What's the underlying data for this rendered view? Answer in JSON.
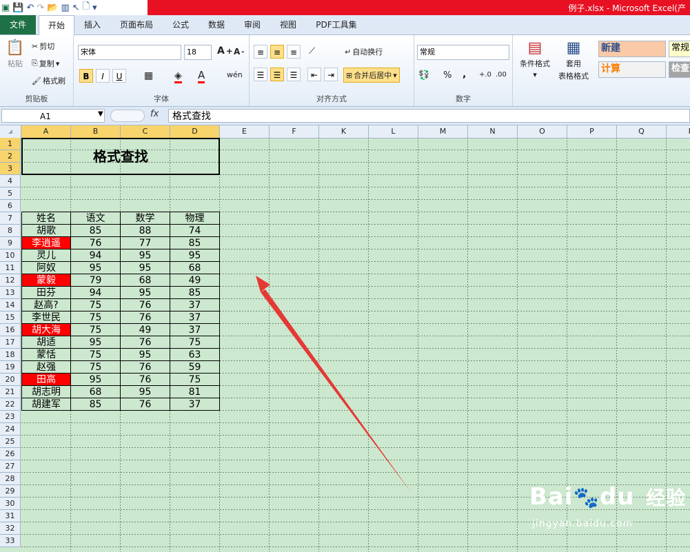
{
  "window": {
    "title": "例子.xlsx  -  Microsoft Excel(产"
  },
  "tabs": [
    "文件",
    "开始",
    "插入",
    "页面布局",
    "公式",
    "数据",
    "审阅",
    "视图",
    "PDF工具集"
  ],
  "ribbon": {
    "clipboard": {
      "label": "剪贴板",
      "paste": "粘贴",
      "cut": "剪切",
      "copy": "复制",
      "format_painter": "格式刷"
    },
    "font": {
      "label": "字体",
      "name": "宋体",
      "size": "18",
      "bold": "B",
      "italic": "I",
      "underline": "U"
    },
    "alignment": {
      "label": "对齐方式",
      "wrap": "自动换行",
      "merge": "合并后居中"
    },
    "number": {
      "label": "数字",
      "format": "常规",
      "percent": "%",
      "comma": ","
    },
    "styles": {
      "conditional": "条件格式",
      "table1": "套用",
      "table2": "表格格式",
      "style_new": "新建",
      "style_calc": "计算",
      "style_normal": "常规",
      "style_check": "检查"
    }
  },
  "formula_bar": {
    "name_box": "A1",
    "fx": "fx",
    "content": "格式查找"
  },
  "columns": [
    "A",
    "B",
    "C",
    "D",
    "E",
    "F",
    "K",
    "L",
    "M",
    "N",
    "O",
    "P",
    "Q",
    "R"
  ],
  "rows": [
    "1",
    "2",
    "3",
    "4",
    "5",
    "6",
    "7",
    "8",
    "9",
    "10",
    "11",
    "12",
    "13",
    "14",
    "15",
    "16",
    "17",
    "18",
    "19",
    "20",
    "21",
    "22",
    "23",
    "24",
    "25",
    "26",
    "27",
    "28",
    "29",
    "30",
    "31",
    "32",
    "33"
  ],
  "sheet": {
    "title": "格式查找",
    "headers": [
      "姓名",
      "语文",
      "数学",
      "物理"
    ],
    "records": [
      {
        "name": "胡歌",
        "chinese": "85",
        "math": "88",
        "physics": "74",
        "highlight": false
      },
      {
        "name": "李逍遥",
        "chinese": "76",
        "math": "77",
        "physics": "85",
        "highlight": true
      },
      {
        "name": "灵儿",
        "chinese": "94",
        "math": "95",
        "physics": "95",
        "highlight": false
      },
      {
        "name": "阿奴",
        "chinese": "95",
        "math": "95",
        "physics": "68",
        "highlight": false
      },
      {
        "name": "蒙毅",
        "chinese": "79",
        "math": "68",
        "physics": "49",
        "highlight": true
      },
      {
        "name": "田芬",
        "chinese": "94",
        "math": "95",
        "physics": "85",
        "highlight": false
      },
      {
        "name": "赵高?",
        "chinese": "75",
        "math": "76",
        "physics": "37",
        "highlight": false
      },
      {
        "name": "李世民",
        "chinese": "75",
        "math": "76",
        "physics": "37",
        "highlight": false
      },
      {
        "name": "胡大海",
        "chinese": "75",
        "math": "49",
        "physics": "37",
        "highlight": true
      },
      {
        "name": "胡适",
        "chinese": "95",
        "math": "76",
        "physics": "75",
        "highlight": false
      },
      {
        "name": "蒙恬",
        "chinese": "75",
        "math": "95",
        "physics": "63",
        "highlight": false
      },
      {
        "name": "赵强",
        "chinese": "75",
        "math": "76",
        "physics": "59",
        "highlight": false
      },
      {
        "name": "田高",
        "chinese": "95",
        "math": "76",
        "physics": "75",
        "highlight": true
      },
      {
        "name": "胡志明",
        "chinese": "68",
        "math": "95",
        "physics": "81",
        "highlight": false
      },
      {
        "name": "胡建军",
        "chinese": "85",
        "math": "76",
        "physics": "37",
        "highlight": false
      }
    ]
  },
  "watermark": {
    "brand": "Bai",
    "brand2": "du",
    "cn": "经验",
    "url": "jingyan.baidu.com"
  },
  "colors": {
    "highlight": "#ff0000",
    "sheet_bg": "#cce8cf",
    "arrow": "#e53935"
  }
}
